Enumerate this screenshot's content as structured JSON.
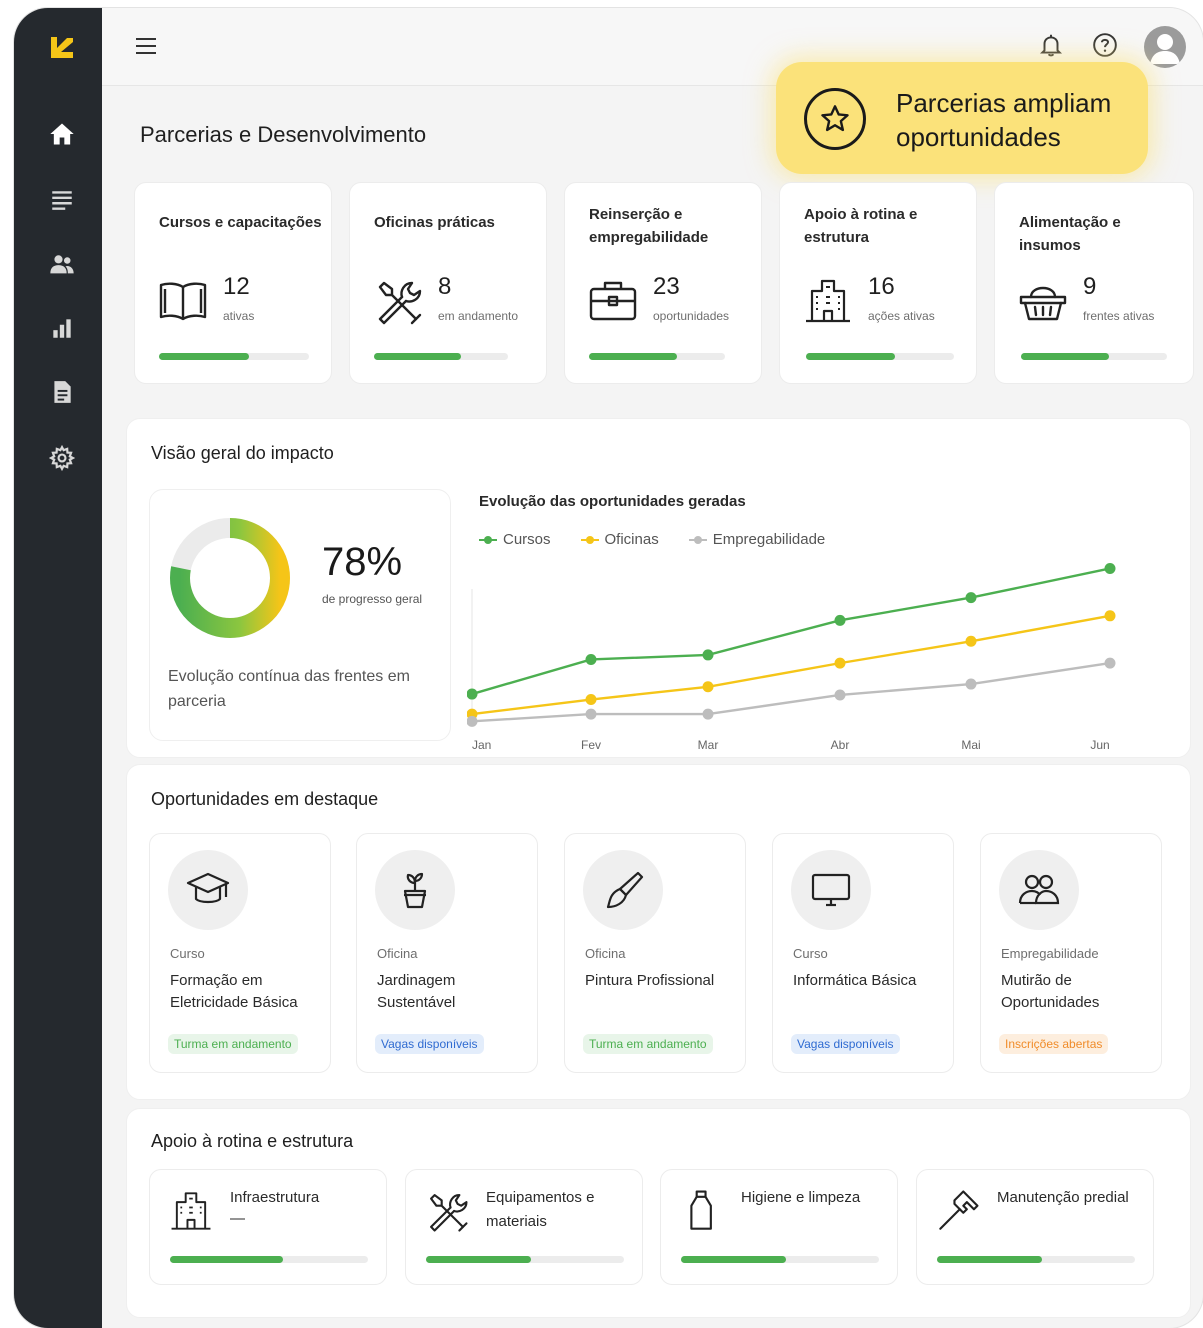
{
  "header": {
    "page_title": "Parcerias e Desenvolvimento",
    "callout_text": "Parcerias ampliam oportunidades",
    "icons": [
      "menu-icon",
      "bell-icon",
      "help-icon",
      "user-avatar-icon"
    ]
  },
  "sidebar": {
    "items": [
      {
        "icon": "home-icon",
        "active": true
      },
      {
        "icon": "list-icon"
      },
      {
        "icon": "users-icon"
      },
      {
        "icon": "bar-chart-icon"
      },
      {
        "icon": "document-icon"
      },
      {
        "icon": "gear-icon"
      }
    ]
  },
  "stats": [
    {
      "title": "Cursos e capacitações",
      "value": "12",
      "sub": "ativas",
      "icon": "book-icon",
      "progress": 0.6
    },
    {
      "title": "Oficinas práticas",
      "value": "8",
      "sub": "em andamento",
      "icon": "tools-icon",
      "progress": 0.65
    },
    {
      "title": "Reinserção e empregabilidade",
      "value": "23",
      "sub": "oportunidades",
      "icon": "briefcase-icon",
      "progress": 0.65
    },
    {
      "title": "Apoio à rotina e estrutura",
      "value": "16",
      "sub": "ações ativas",
      "icon": "building-icon",
      "progress": 0.6
    },
    {
      "title": "Alimentação e insumos",
      "value": "9",
      "sub": "frentes ativas",
      "icon": "basket-icon",
      "progress": 0.6
    }
  ],
  "impact": {
    "title": "Visão geral do impacto",
    "donut_percent": "78%",
    "donut_percent_value": 78,
    "donut_sub": "de progresso geral",
    "caption": "Evolução contínua das frentes em parceria",
    "colors": {
      "green": "#4caf50",
      "yellow": "#f5c518",
      "track": "#ebebeb"
    }
  },
  "chart_data": {
    "type": "line",
    "title": "Evolução das oportunidades geradas",
    "categories": [
      "Jan",
      "Fev",
      "Mar",
      "Abr",
      "Mai",
      "Jun"
    ],
    "series": [
      {
        "name": "Cursos",
        "color": "#4caf50",
        "values": [
          34,
          72,
          77,
          115,
          140,
          172
        ]
      },
      {
        "name": "Oficinas",
        "color": "#f5c518",
        "values": [
          12,
          28,
          42,
          68,
          92,
          120
        ]
      },
      {
        "name": "Empregabilidade",
        "color": "#bdbdbd",
        "values": [
          4,
          12,
          12,
          33,
          45,
          68
        ]
      }
    ],
    "ylim": [
      0,
      200
    ],
    "grid": false,
    "legend": "top-left"
  },
  "featured": {
    "title": "Oportunidades em destaque",
    "items": [
      {
        "category": "Curso",
        "name": "Formação em Eletricidade Básica",
        "badge": "Turma em andamento",
        "badge_style": "green",
        "icon": "graduation-cap-icon"
      },
      {
        "category": "Oficina",
        "name": "Jardinagem Sustentável",
        "badge": "Vagas disponíveis",
        "badge_style": "blue",
        "icon": "plant-icon"
      },
      {
        "category": "Oficina",
        "name": "Pintura Profissional",
        "badge": "Turma em andamento",
        "badge_style": "green",
        "icon": "paintbrush-icon"
      },
      {
        "category": "Curso",
        "name": "Informática Básica",
        "badge": "Vagas disponíveis",
        "badge_style": "blue",
        "icon": "monitor-icon"
      },
      {
        "category": "Empregabilidade",
        "name": "Mutirão de Oportunidades",
        "badge": "Inscrições abertas",
        "badge_style": "orange",
        "icon": "people-group-icon"
      }
    ]
  },
  "support": {
    "title": "Apoio à rotina e estrutura",
    "items": [
      {
        "title": "Infraestrutura",
        "sub": "—",
        "icon": "building-icon",
        "progress": 0.57
      },
      {
        "title": "Equipamentos e materiais",
        "sub": "",
        "icon": "tools-icon",
        "progress": 0.53
      },
      {
        "title": "Higiene e limpeza",
        "sub": "",
        "icon": "bottle-icon",
        "progress": 0.53
      },
      {
        "title": "Manutenção predial",
        "sub": "",
        "icon": "hammer-icon",
        "progress": 0.53
      }
    ]
  }
}
